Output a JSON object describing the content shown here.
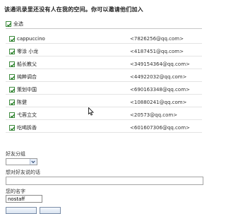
{
  "header": {
    "title": "该通讯录里还没有人在我的空间。你可以邀请他们加入"
  },
  "select_all": {
    "label": "全选",
    "checked": true
  },
  "contacts": [
    {
      "name": "cappuccino",
      "email": "<7826256@qq.com>",
      "checked": true
    },
    {
      "name": "零涂 小龙",
      "email": "<4187451@qq.com>",
      "checked": true
    },
    {
      "name": "船长教父",
      "email": "<349154364@qq.com>",
      "checked": true
    },
    {
      "name": "纯粹调合",
      "email": "<44922032@qq.com>",
      "checked": true
    },
    {
      "name": "策划中国",
      "email": "<690163348@qq.com>",
      "checked": true
    },
    {
      "name": "陈健",
      "email": "<10880241@qq.com>",
      "checked": true
    },
    {
      "name": "弋蓉立文",
      "email": "<20573@qq.com>",
      "checked": true
    },
    {
      "name": "吃喝拆香",
      "email": "<601607306@qq.com>",
      "checked": true
    }
  ],
  "group": {
    "label": "好友分组",
    "selected": ""
  },
  "message": {
    "label": "想对好友说的话",
    "value": ""
  },
  "your_name": {
    "label": "您的名字",
    "value": "nostaff"
  }
}
